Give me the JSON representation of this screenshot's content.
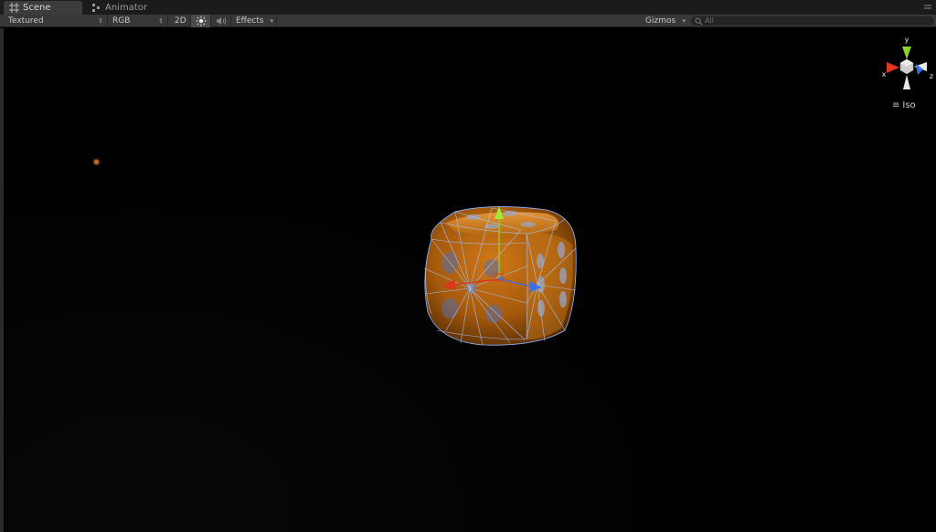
{
  "tabs": [
    {
      "label": "Scene",
      "icon": "grid-icon",
      "active": true
    },
    {
      "label": "Animator",
      "icon": "animator-icon",
      "active": false
    }
  ],
  "toolbar": {
    "draw_mode": "Textured",
    "render_mode": "RGB",
    "mode_2d": "2D",
    "lighting": "sun-icon",
    "audio": "speaker-icon",
    "effects": "Effects",
    "gizmos": "Gizmos",
    "search_placeholder": "All"
  },
  "scene_gizmo": {
    "axis_y": "y",
    "axis_x": "x",
    "axis_z": "z",
    "projection": "Iso"
  },
  "colors": {
    "x_axis": "#e0361f",
    "y_axis": "#8fd02a",
    "z_axis": "#3b6fe6",
    "dice_base": "#b5640f",
    "wireframe": "#8fb8ff"
  }
}
